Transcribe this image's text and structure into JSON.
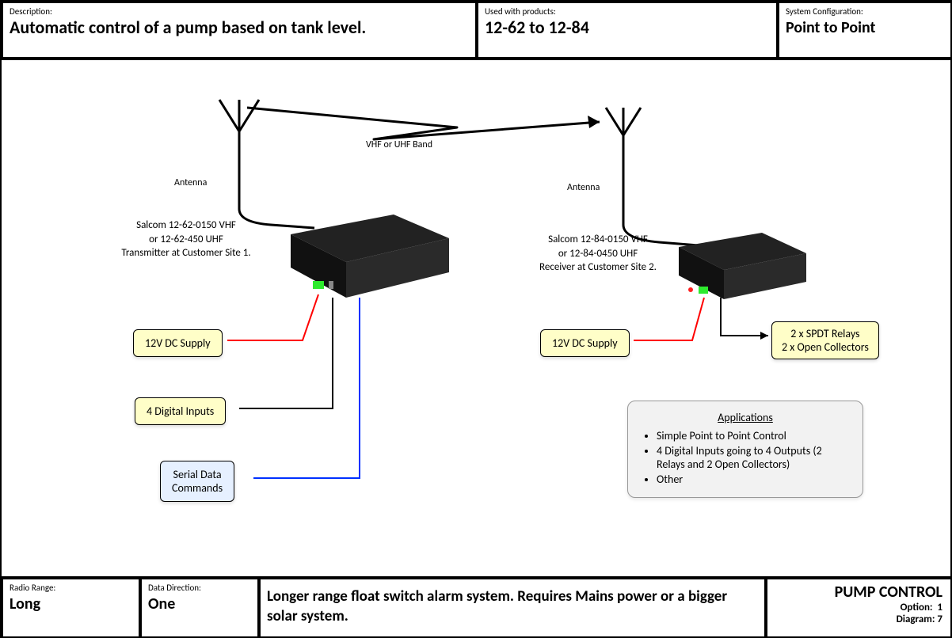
{
  "header": {
    "description_label": "Description:",
    "description_value": "Automatic control of a pump based on tank level.",
    "products_label": "Used with products:",
    "products_value": "12-62 to 12-84",
    "config_label": "System Configuration:",
    "config_value": "Point to Point"
  },
  "diagram": {
    "band_text": "VHF or UHF Band",
    "antenna_left": "Antenna",
    "antenna_right": "Antenna",
    "device_left_l1": "Salcom 12-62-0150 VHF",
    "device_left_l2": "or 12-62-450 UHF",
    "device_left_l3": "Transmitter at Customer Site 1.",
    "device_right_l1": "Salcom 12-84-0150 VHF",
    "device_right_l2": "or 12-84-0450 UHF",
    "device_right_l3": "Receiver at Customer Site 2.",
    "supply_left": "12V DC Supply",
    "supply_right": "12V DC Supply",
    "digital_inputs": "4 Digital Inputs",
    "serial_cmds": "Serial Data\nCommands",
    "relays_l1": "2 x SPDT Relays",
    "relays_l2": "2 x Open Collectors",
    "apps_title": "Applications",
    "apps_items": [
      "Simple Point to Point Control",
      "4 Digital Inputs going to 4 Outputs (2 Relays and 2 Open Collectors)",
      "Other"
    ]
  },
  "footer": {
    "range_label": "Radio Range:",
    "range_value": "Long",
    "direction_label": "Data Direction:",
    "direction_value": "One",
    "notes": "Longer range float switch alarm system. Requires Mains power or a bigger solar system.",
    "title": "PUMP CONTROL",
    "option_label": "Option:",
    "option_value": "1",
    "diagram_label": "Diagram:",
    "diagram_value": "7"
  }
}
